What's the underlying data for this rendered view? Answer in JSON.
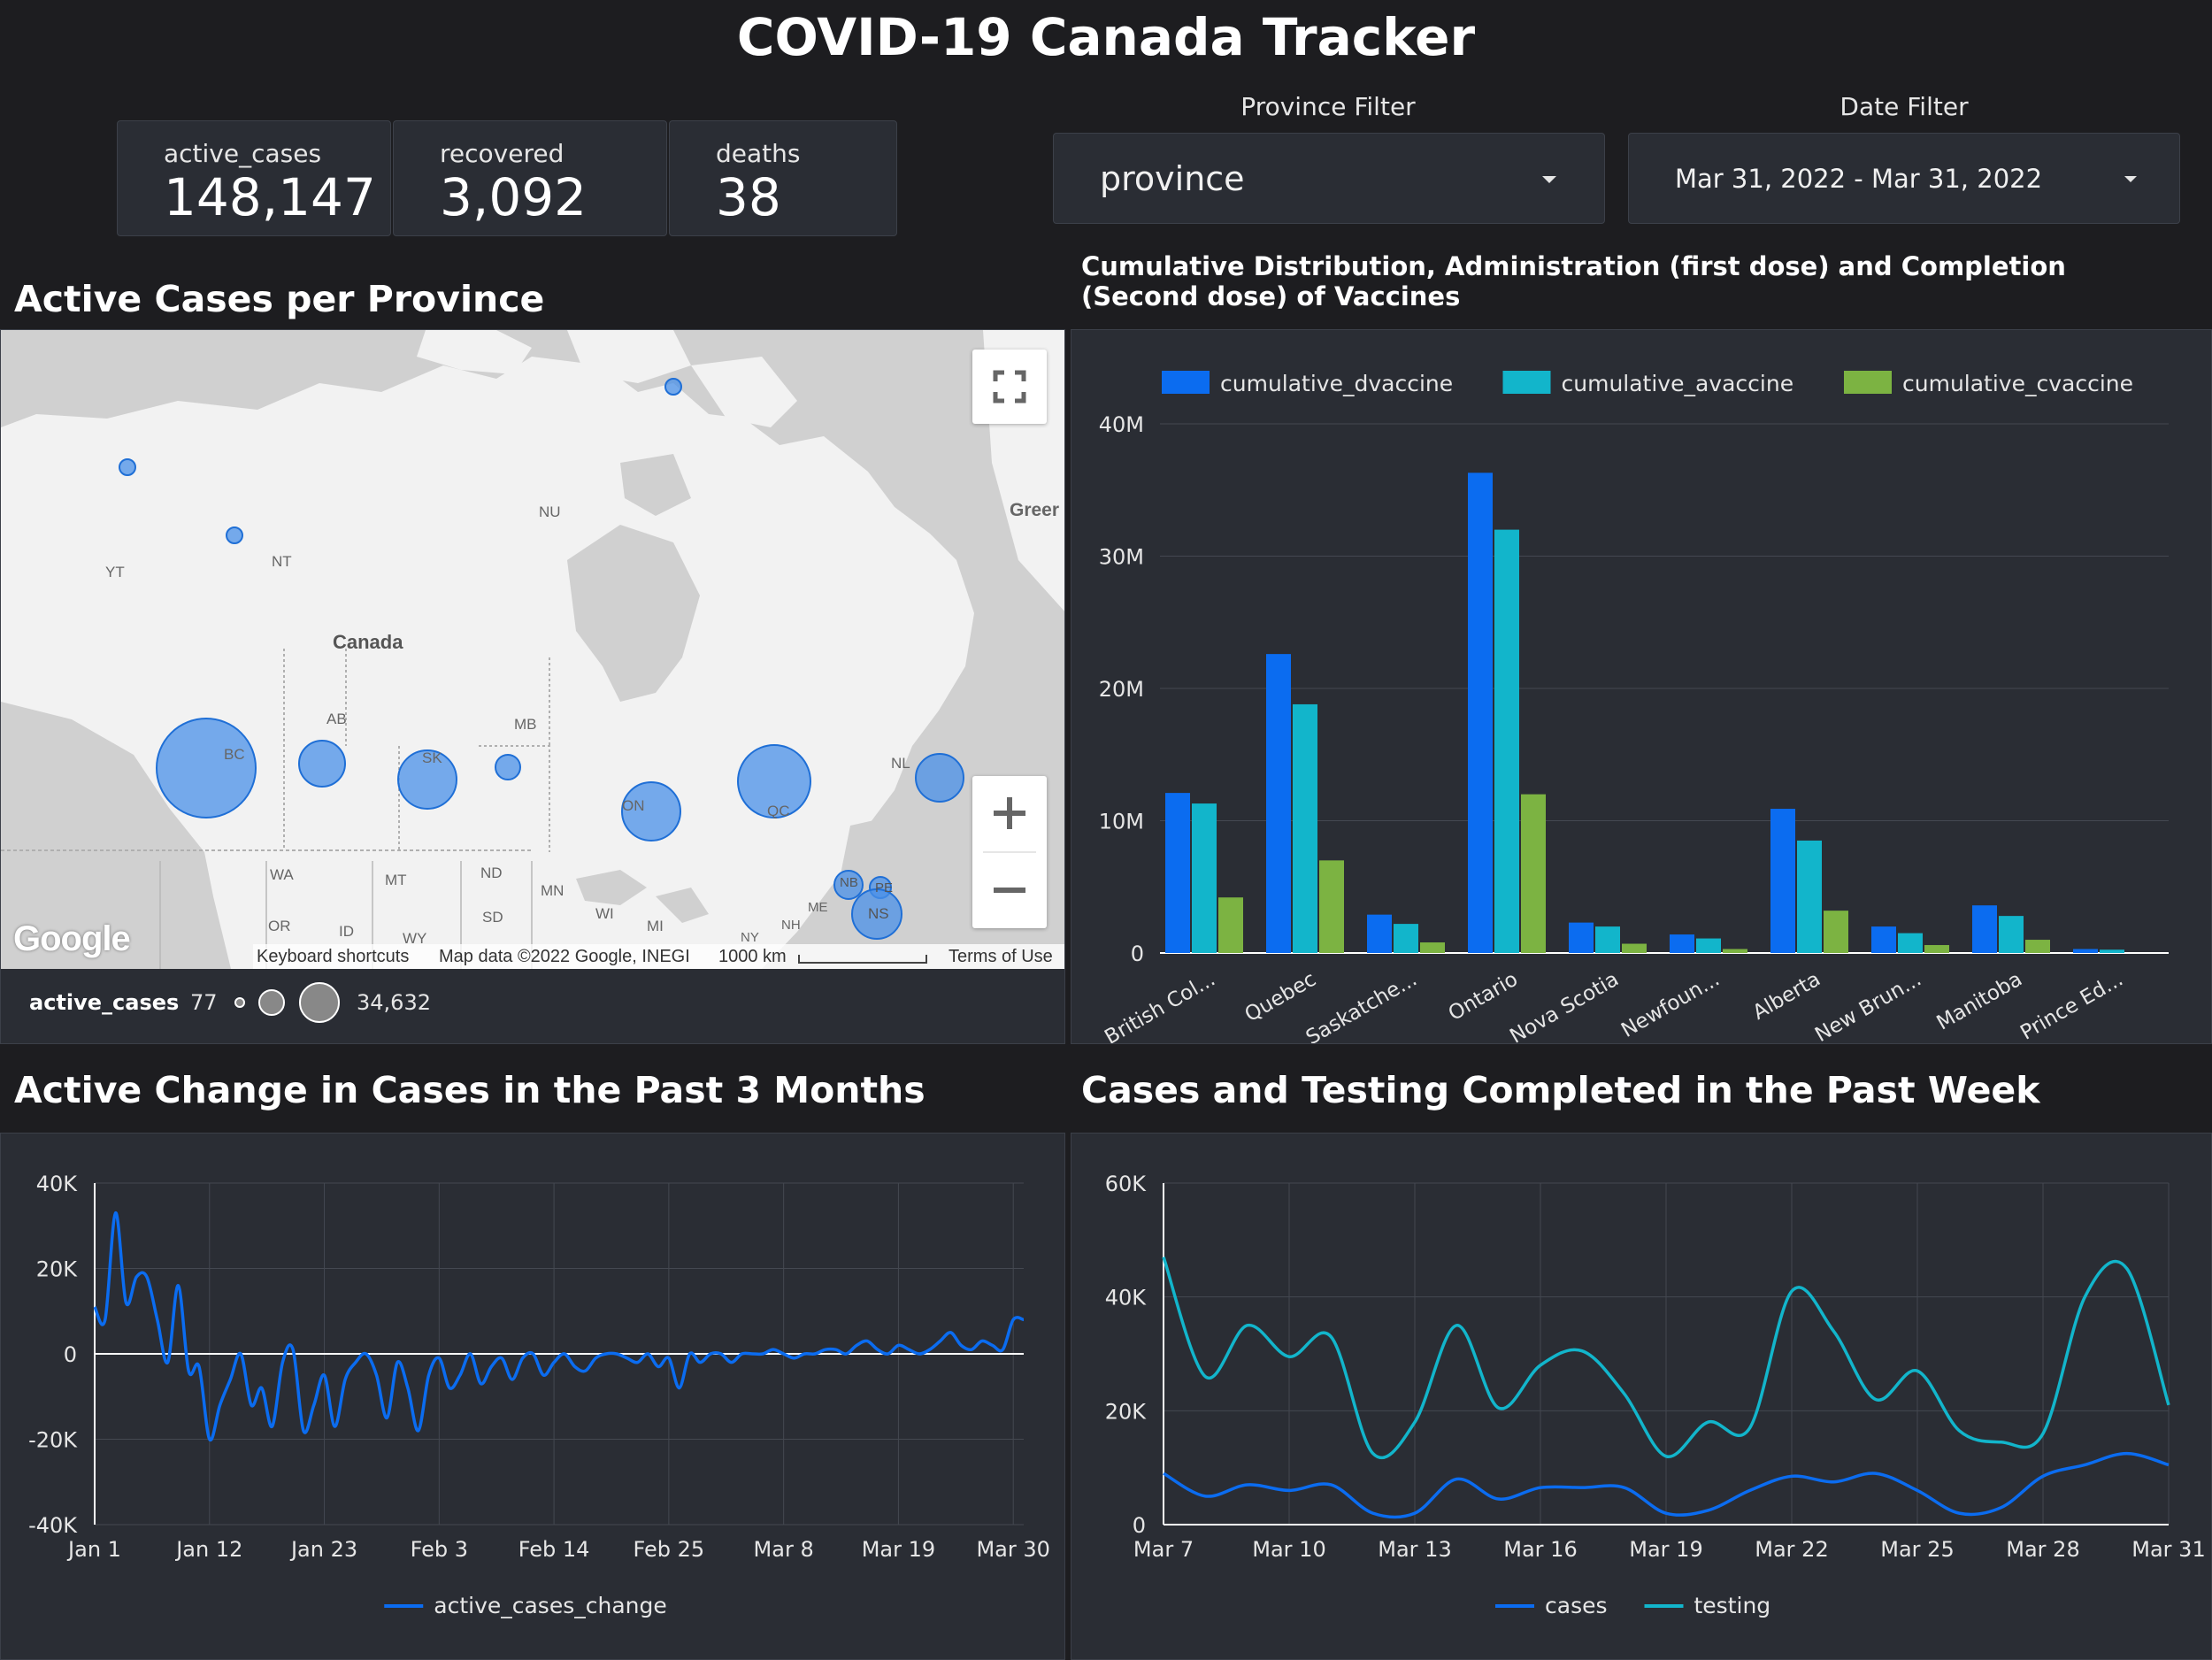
{
  "title": "COVID-19 Canada Tracker",
  "kpis": {
    "active": {
      "label": "active_cases",
      "value": "148,147"
    },
    "recovered": {
      "label": "recovered",
      "value": "3,092"
    },
    "deaths": {
      "label": "deaths",
      "value": "38"
    }
  },
  "filters": {
    "province": {
      "label": "Province Filter",
      "value": "province"
    },
    "date": {
      "label": "Date Filter",
      "value": "Mar 31, 2022 - Mar 31, 2022"
    }
  },
  "map": {
    "title": "Active Cases per Province",
    "region_labels": {
      "canada": "Canada",
      "nu": "NU",
      "nt": "NT",
      "yt": "YT",
      "greenland": "Greer",
      "bc": "BC",
      "ab": "AB",
      "sk": "SK",
      "mb": "MB",
      "on": "ON",
      "qc": "QC",
      "nl": "NL",
      "nb": "NB",
      "pe": "PE",
      "ns": "NS",
      "wa": "WA",
      "mt": "MT",
      "nd": "ND",
      "mn": "MN",
      "or": "OR",
      "id": "ID",
      "wy": "WY",
      "sd": "SD",
      "wi": "WI",
      "mi": "MI",
      "ny": "NY",
      "nh": "NH",
      "me": "ME"
    },
    "attribution": {
      "logo": "Google",
      "shortcuts": "Keyboard shortcuts",
      "map_data": "Map data ©2022 Google, INEGI",
      "scale": "1000 km",
      "terms": "Terms of Use"
    },
    "legend": {
      "metric": "active_cases",
      "min": "77",
      "max": "34,632"
    },
    "bubble_color": "#4a90e8"
  },
  "vaccines": {
    "title": "Cumulative Distribution, Administration (first dose) and Completion (Second dose) of Vaccines"
  },
  "active_change": {
    "title": "Active Change in Cases in the Past 3 Months"
  },
  "cases_testing": {
    "title": "Cases and Testing Completed in the Past Week"
  },
  "colors": {
    "background": "#1d1d20",
    "panel": "#2a2d34",
    "blue": "#0b6cf0",
    "teal": "#12b5cb",
    "green": "#7cb342",
    "grid": "#444851"
  },
  "chart_data": [
    {
      "type": "bar",
      "title": "Cumulative Distribution, Administration (first dose) and Completion (Second dose) of Vaccines",
      "categories": [
        "British Col...",
        "Quebec",
        "Saskatche...",
        "Ontario",
        "Nova Scotia",
        "Newfoun...",
        "Alberta",
        "New Brun...",
        "Manitoba",
        "Prince Ed..."
      ],
      "series": [
        {
          "name": "cumulative_dvaccine",
          "color": "#0b6cf0",
          "values": [
            12100000,
            22600000,
            2900000,
            36300000,
            2300000,
            1400000,
            10900000,
            2000000,
            3600000,
            300000
          ]
        },
        {
          "name": "cumulative_avaccine",
          "color": "#12b5cb",
          "values": [
            11300000,
            18800000,
            2200000,
            32000000,
            2000000,
            1100000,
            8500000,
            1500000,
            2800000,
            250000
          ]
        },
        {
          "name": "cumulative_cvaccine",
          "color": "#7cb342",
          "values": [
            4200000,
            7000000,
            800000,
            12000000,
            700000,
            300000,
            3200000,
            600000,
            1000000,
            0
          ]
        }
      ],
      "yticks": [
        "40M",
        "30M",
        "20M",
        "10M",
        "0"
      ],
      "ylim": [
        0,
        40000000
      ],
      "legend": "top",
      "grid": true
    },
    {
      "type": "line",
      "title": "Active Change in Cases in the Past 3 Months",
      "x": [
        "Jan 1",
        "Jan 2",
        "Jan 3",
        "Jan 4",
        "Jan 5",
        "Jan 6",
        "Jan 7",
        "Jan 8",
        "Jan 9",
        "Jan 10",
        "Jan 11",
        "Jan 12",
        "Jan 13",
        "Jan 14",
        "Jan 15",
        "Jan 16",
        "Jan 17",
        "Jan 18",
        "Jan 19",
        "Jan 20",
        "Jan 21",
        "Jan 22",
        "Jan 23",
        "Jan 24",
        "Jan 25",
        "Jan 26",
        "Jan 27",
        "Jan 28",
        "Jan 29",
        "Jan 30",
        "Jan 31",
        "Feb 1",
        "Feb 2",
        "Feb 3",
        "Feb 4",
        "Feb 5",
        "Feb 6",
        "Feb 7",
        "Feb 8",
        "Feb 9",
        "Feb 10",
        "Feb 11",
        "Feb 12",
        "Feb 13",
        "Feb 14",
        "Feb 15",
        "Feb 16",
        "Feb 17",
        "Feb 18",
        "Feb 19",
        "Feb 20",
        "Feb 21",
        "Feb 22",
        "Feb 23",
        "Feb 24",
        "Feb 25",
        "Feb 26",
        "Feb 27",
        "Feb 28",
        "Mar 1",
        "Mar 2",
        "Mar 3",
        "Mar 4",
        "Mar 5",
        "Mar 6",
        "Mar 7",
        "Mar 8",
        "Mar 9",
        "Mar 10",
        "Mar 11",
        "Mar 12",
        "Mar 13",
        "Mar 14",
        "Mar 15",
        "Mar 16",
        "Mar 17",
        "Mar 18",
        "Mar 19",
        "Mar 20",
        "Mar 21",
        "Mar 22",
        "Mar 23",
        "Mar 24",
        "Mar 25",
        "Mar 26",
        "Mar 27",
        "Mar 28",
        "Mar 29",
        "Mar 30",
        "Mar 31"
      ],
      "series": [
        {
          "name": "active_cases_change",
          "color": "#0b6cf0",
          "values": [
            11000,
            8000,
            33000,
            12000,
            18000,
            18000,
            8000,
            -2000,
            16000,
            -4000,
            -3000,
            -20000,
            -12000,
            -6000,
            0,
            -12000,
            -8000,
            -17000,
            -2000,
            1000,
            -18000,
            -12000,
            -5000,
            -17000,
            -6000,
            -2000,
            0,
            -5000,
            -15000,
            -2000,
            -8000,
            -18000,
            -5000,
            -1000,
            -8000,
            -5000,
            0,
            -7000,
            -3000,
            -1000,
            -6000,
            -1000,
            0,
            -5000,
            -2000,
            0,
            -3000,
            -4000,
            -1000,
            0,
            0,
            -1000,
            -2000,
            0,
            -3000,
            -1000,
            -8000,
            0,
            -2000,
            0,
            0,
            -2000,
            0,
            0,
            0,
            1000,
            0,
            -1000,
            0,
            0,
            1000,
            1000,
            0,
            2000,
            3000,
            1000,
            0,
            2000,
            1000,
            0,
            1000,
            3000,
            5000,
            2000,
            1000,
            3000,
            2000,
            1000,
            8000,
            8000
          ]
        }
      ],
      "xticks": [
        "Jan 1",
        "Jan 12",
        "Jan 23",
        "Feb 3",
        "Feb 14",
        "Feb 25",
        "Mar 8",
        "Mar 19",
        "Mar 30"
      ],
      "yticks": [
        "40K",
        "20K",
        "0",
        "-20K",
        "-40K"
      ],
      "ylim": [
        -40000,
        40000
      ],
      "legend": "bottom",
      "grid": true
    },
    {
      "type": "line",
      "title": "Cases and Testing Completed in the Past Week",
      "x": [
        "Mar 7",
        "Mar 8",
        "Mar 9",
        "Mar 10",
        "Mar 11",
        "Mar 12",
        "Mar 13",
        "Mar 14",
        "Mar 15",
        "Mar 16",
        "Mar 17",
        "Mar 18",
        "Mar 19",
        "Mar 20",
        "Mar 21",
        "Mar 22",
        "Mar 23",
        "Mar 24",
        "Mar 25",
        "Mar 26",
        "Mar 27",
        "Mar 28",
        "Mar 29",
        "Mar 30",
        "Mar 31"
      ],
      "series": [
        {
          "name": "cases",
          "color": "#0b6cf0",
          "values": [
            9000,
            5000,
            7000,
            6000,
            7000,
            2000,
            2000,
            8000,
            4500,
            6500,
            6500,
            6500,
            2000,
            2500,
            6000,
            8500,
            7500,
            9000,
            6000,
            2000,
            3000,
            8500,
            10500,
            12500,
            10500
          ]
        },
        {
          "name": "testing",
          "color": "#12b5cb",
          "values": [
            47000,
            26000,
            35000,
            29500,
            33000,
            12500,
            18000,
            35000,
            20500,
            28000,
            30500,
            23000,
            12000,
            18000,
            17000,
            41000,
            34000,
            22000,
            27000,
            16500,
            14500,
            16000,
            40000,
            45000,
            21000
          ]
        }
      ],
      "xticks": [
        "Mar 7",
        "Mar 10",
        "Mar 13",
        "Mar 16",
        "Mar 19",
        "Mar 22",
        "Mar 25",
        "Mar 28",
        "Mar 31"
      ],
      "yticks": [
        "60K",
        "40K",
        "20K",
        "0"
      ],
      "ylim": [
        0,
        60000
      ],
      "legend": "bottom",
      "grid": true
    }
  ]
}
